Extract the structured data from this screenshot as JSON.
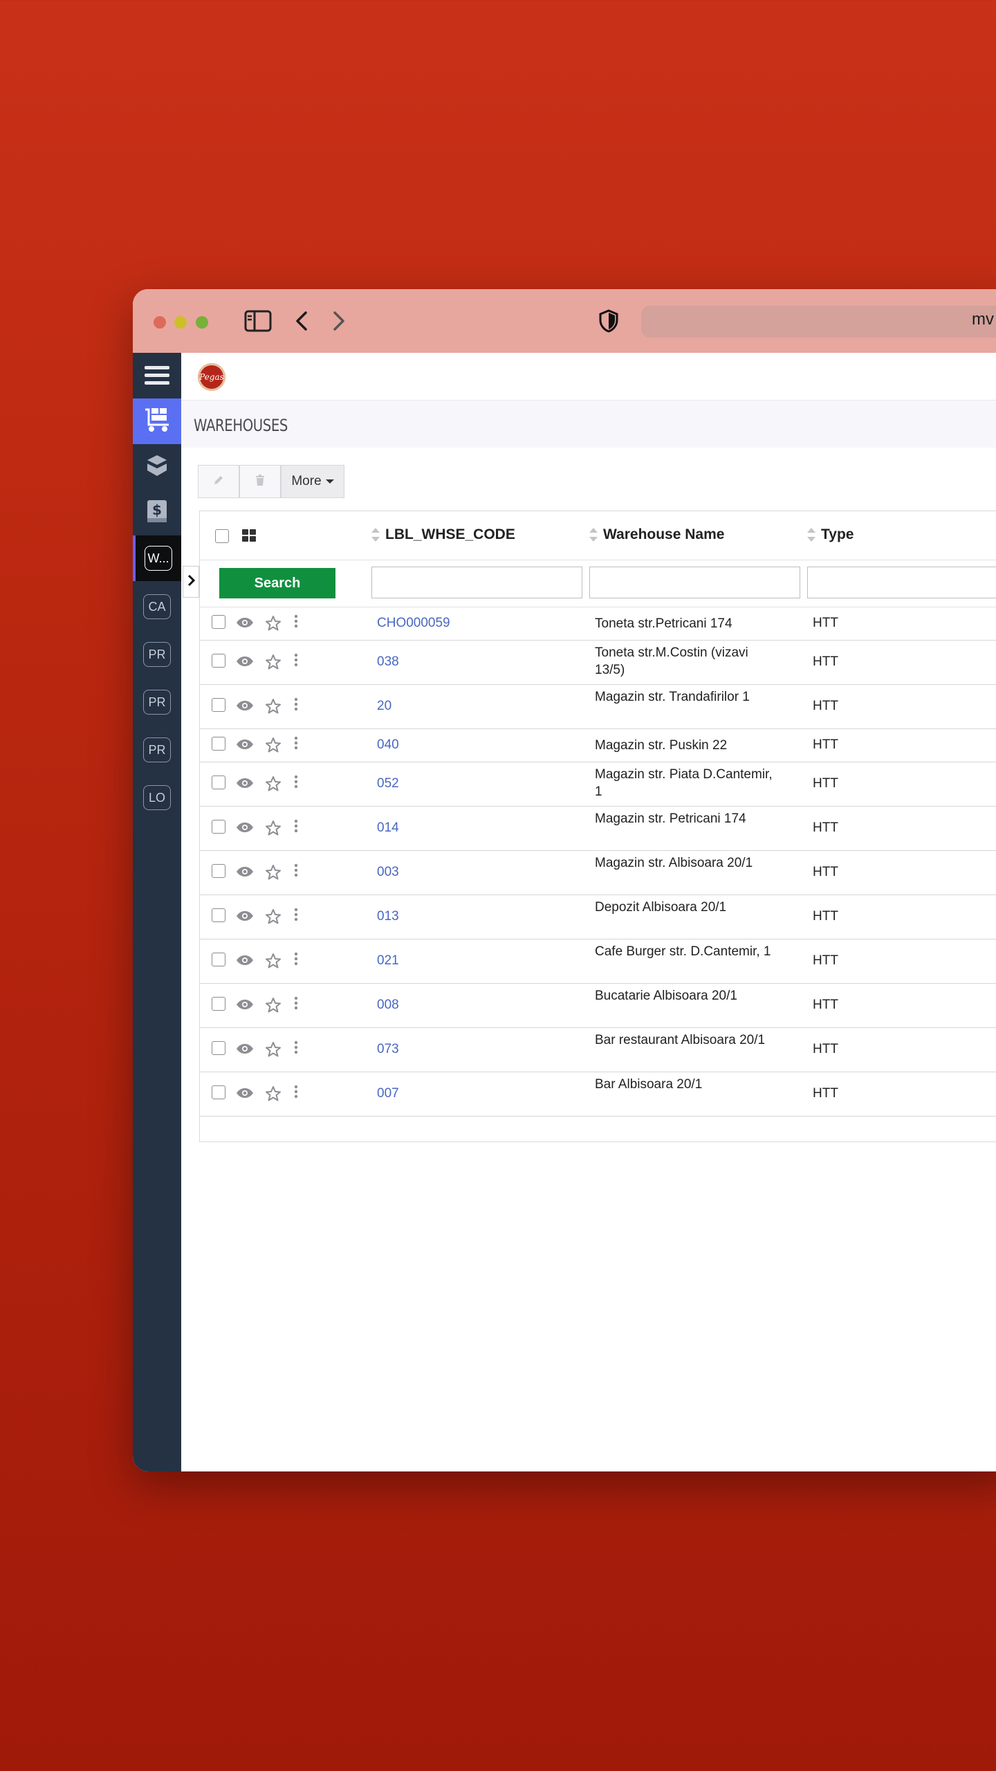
{
  "browser": {
    "url_partial": "mv"
  },
  "app": {
    "logo_text": "Pegas",
    "page_title": "WAREHOUSES"
  },
  "sidebar": {
    "items": [
      {
        "icon": "hamburger-menu-icon"
      },
      {
        "icon": "warehouse-cart-icon",
        "active": true
      },
      {
        "icon": "boxes-icon"
      },
      {
        "icon": "finance-book-icon"
      },
      {
        "label": "W...",
        "active": true
      },
      {
        "label": "CA"
      },
      {
        "label": "PR"
      },
      {
        "label": "PR"
      },
      {
        "label": "PR"
      },
      {
        "label": "LO"
      }
    ]
  },
  "toolbar": {
    "more_label": "More"
  },
  "table": {
    "columns": {
      "code": "LBL_WHSE_CODE",
      "name": "Warehouse Name",
      "type": "Type"
    },
    "search_label": "Search",
    "rows": [
      {
        "code": "CHO000059",
        "name": "Toneta str.Petricani 174",
        "type": "HTT"
      },
      {
        "code": "038",
        "name": "Toneta str.M.Costin (vizavi 13/5)",
        "type": "HTT"
      },
      {
        "code": "20",
        "name": "Magazin str. Trandafirilor 1",
        "type": "HTT"
      },
      {
        "code": "040",
        "name": "Magazin str. Puskin 22",
        "type": "HTT"
      },
      {
        "code": "052",
        "name": "Magazin str. Piata D.Cantemir, 1",
        "type": "HTT"
      },
      {
        "code": "014",
        "name": "Magazin str. Petricani 174",
        "type": "HTT"
      },
      {
        "code": "003",
        "name": "Magazin str. Albisoara 20/1",
        "type": "HTT"
      },
      {
        "code": "013",
        "name": "Depozit Albisoara 20/1",
        "type": "HTT"
      },
      {
        "code": "021",
        "name": "Cafe Burger str. D.Cantemir, 1",
        "type": "HTT"
      },
      {
        "code": "008",
        "name": "Bucatarie Albisoara 20/1",
        "type": "HTT"
      },
      {
        "code": "073",
        "name": "Bar restaurant Albisoara 20/1",
        "type": "HTT"
      },
      {
        "code": "007",
        "name": "Bar Albisoara 20/1",
        "type": "HTT"
      }
    ]
  }
}
